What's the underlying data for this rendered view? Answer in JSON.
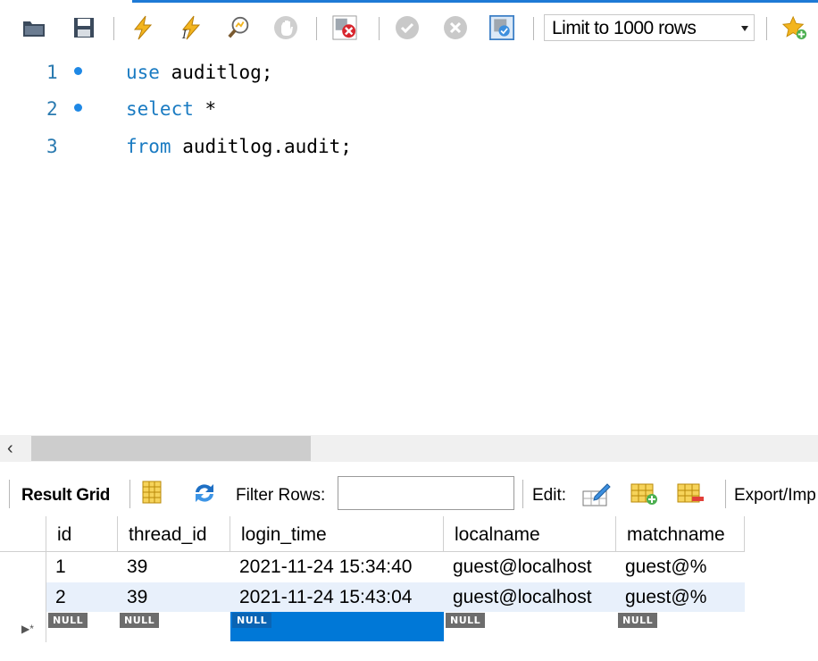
{
  "toolbar": {
    "limit_select": "Limit to 1000 rows"
  },
  "editor": {
    "lines": [
      {
        "number": "1",
        "keyword": "use",
        "rest": " auditlog;"
      },
      {
        "number": "2",
        "keyword": "select",
        "rest": " *"
      },
      {
        "number": "3",
        "keyword": "from",
        "rest": " auditlog.audit;"
      }
    ]
  },
  "results": {
    "result_grid_label": "Result Grid",
    "filter_label": "Filter Rows:",
    "filter_value": "",
    "edit_label": "Edit:",
    "export_label": "Export/Imp",
    "columns": [
      "id",
      "thread_id",
      "login_time",
      "localname",
      "matchname"
    ],
    "rows": [
      [
        "1",
        "39",
        "2021-11-24 15:34:40",
        "guest@localhost",
        "guest@%"
      ],
      [
        "2",
        "39",
        "2021-11-24 15:43:04",
        "guest@localhost",
        "guest@%"
      ]
    ],
    "new_row_marker": "▶*",
    "null_label": "NULL"
  },
  "colors": {
    "keyword": "#1a7bc2",
    "line_number": "#2a7ab0",
    "selection": "#0078d7",
    "row_alt": "#e8f0fb"
  },
  "icons": [
    "open-folder-icon",
    "save-icon",
    "execute-icon",
    "execute-current-icon",
    "explain-icon",
    "stop-icon",
    "toggle-error-icon",
    "commit-icon",
    "rollback-icon",
    "autocommit-icon",
    "add-snippet-icon",
    "grid-icon",
    "refresh-icon",
    "edit-row-icon",
    "add-row-icon",
    "delete-row-icon"
  ]
}
